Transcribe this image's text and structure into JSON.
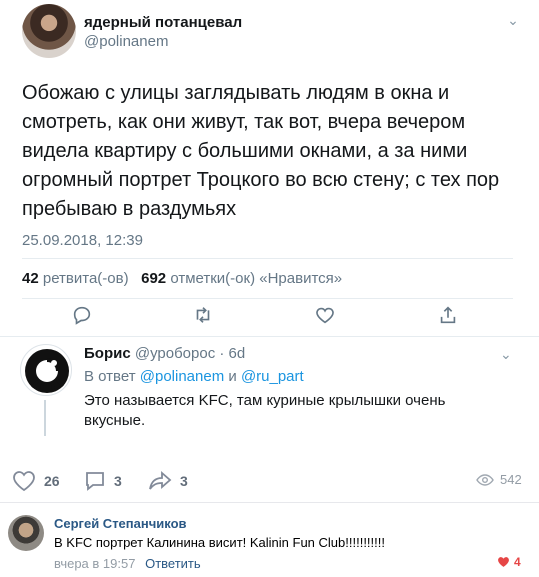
{
  "tweet": {
    "display_name": "ядерный потанцевал",
    "handle": "@polinanem",
    "text": "Обожаю с улицы заглядывать людям в окна и смотреть, как они живут, так вот, вчера вечером видела квартиру с большими окнами, а за ними огромный портрет Троцкого во всю стену; с тех пор пребываю в раздумьях",
    "timestamp": "25.09.2018, 12:39",
    "retweets_count": "42",
    "retweets_label": "ретвита(-ов)",
    "likes_count": "692",
    "likes_label": "отметки(-ок) «Нравится»"
  },
  "reply": {
    "display_name": "Борис",
    "handle_and_age": "@уроборос · 6d",
    "reply_prefix": "В ответ",
    "mention_1": "@polinanem",
    "conjunction": "и",
    "mention_2": "@ru_part",
    "text": "Это называется KFC, там куриные крылышки очень вкусные."
  },
  "vk_post": {
    "likes": "26",
    "comments": "3",
    "shares": "3",
    "views": "542"
  },
  "comment": {
    "author": "Сергей Степанчиков",
    "text": "В KFC портрет Калинина висит! Kalinin Fun Club!!!!!!!!!!!",
    "time": "вчера в 19:57",
    "reply_label": "Ответить",
    "likes": "4"
  },
  "colors": {
    "twitter_link": "#1b95e0",
    "vk_link": "#2a5885",
    "like_red": "#e64646",
    "muted": "#657786"
  },
  "icons": [
    "chevron-down-icon",
    "reply-icon",
    "retweet-icon",
    "like-icon",
    "share-icon",
    "heart-icon",
    "comment-icon",
    "share-arrow-icon",
    "eye-icon"
  ]
}
